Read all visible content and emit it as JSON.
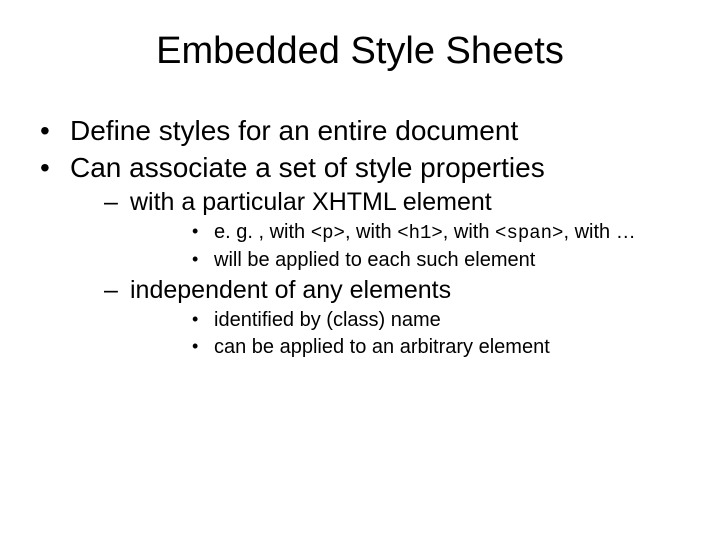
{
  "title": "Embedded Style Sheets",
  "bullets": {
    "b1": "Define styles for an entire document",
    "b2": "Can associate a set of style properties",
    "b2a": "with a particular XHTML element",
    "b2a_eg_prefix": "e. g. , with ",
    "b2a_eg_code1": "<p>",
    "b2a_eg_mid1": ", with ",
    "b2a_eg_code2": "<h1>",
    "b2a_eg_mid2": ", with ",
    "b2a_eg_code3": "<span>",
    "b2a_eg_suffix": ", with …",
    "b2a2": "will be applied to each such element",
    "b2b": "independent of any elements",
    "b2b1": "identified by (class) name",
    "b2b2": "can be applied to an arbitrary element"
  }
}
